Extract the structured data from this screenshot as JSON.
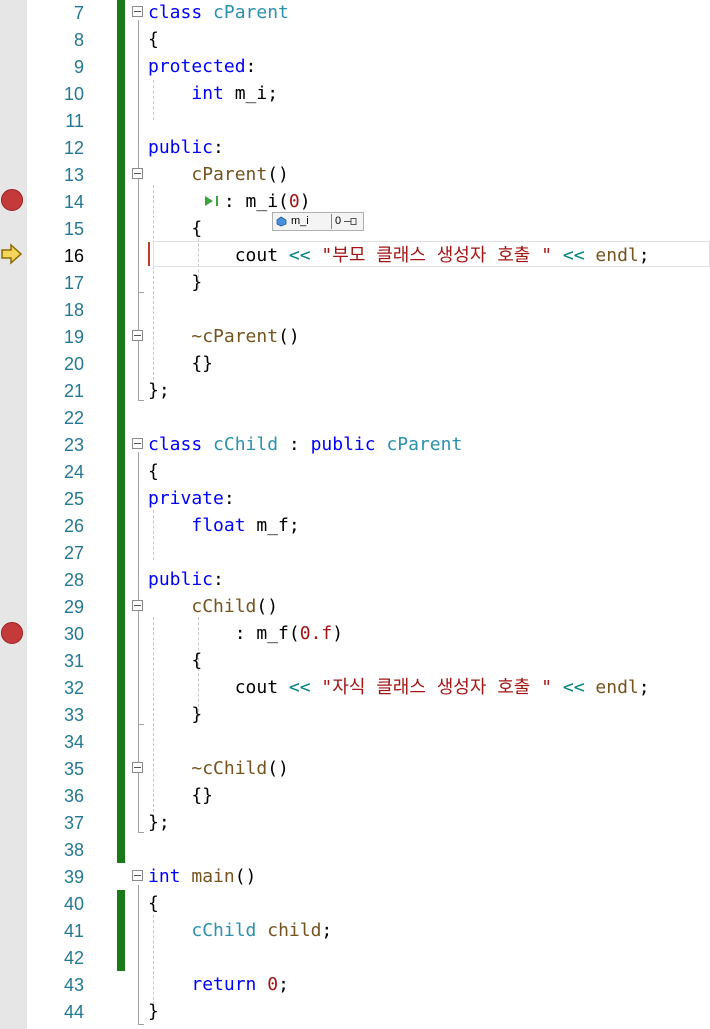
{
  "editor": {
    "lines": [
      {
        "num": "7",
        "tokens": [
          {
            "t": "class",
            "c": "kw"
          },
          {
            "t": " "
          },
          {
            "t": "cParent",
            "c": "type"
          }
        ]
      },
      {
        "num": "8",
        "tokens": [
          {
            "t": "{"
          }
        ]
      },
      {
        "num": "9",
        "tokens": [
          {
            "t": "protected",
            "c": "kw"
          },
          {
            "t": ":"
          }
        ]
      },
      {
        "num": "10",
        "tokens": [
          {
            "t": "    "
          },
          {
            "t": "int",
            "c": "kw"
          },
          {
            "t": " m_i;"
          }
        ]
      },
      {
        "num": "11",
        "tokens": []
      },
      {
        "num": "12",
        "tokens": [
          {
            "t": "public",
            "c": "kw"
          },
          {
            "t": ":"
          }
        ]
      },
      {
        "num": "13",
        "tokens": [
          {
            "t": "    "
          },
          {
            "t": "cParent",
            "c": "fn"
          },
          {
            "t": "()"
          }
        ]
      },
      {
        "num": "14",
        "tokens": [
          {
            "t": "       : m_i("
          },
          {
            "t": "0",
            "c": "num"
          },
          {
            "t": ")"
          }
        ]
      },
      {
        "num": "15",
        "tokens": [
          {
            "t": "    {"
          }
        ]
      },
      {
        "num": "16",
        "tokens": [
          {
            "t": "        cout "
          },
          {
            "t": "<<",
            "c": "op"
          },
          {
            "t": " "
          },
          {
            "t": "\"부모 클래스 생성자 호출 \"",
            "c": "str"
          },
          {
            "t": " "
          },
          {
            "t": "<<",
            "c": "op"
          },
          {
            "t": " "
          },
          {
            "t": "endl",
            "c": "fn"
          },
          {
            "t": ";"
          }
        ]
      },
      {
        "num": "17",
        "tokens": [
          {
            "t": "    }"
          }
        ]
      },
      {
        "num": "18",
        "tokens": []
      },
      {
        "num": "19",
        "tokens": [
          {
            "t": "    "
          },
          {
            "t": "~cParent",
            "c": "fn"
          },
          {
            "t": "()"
          }
        ]
      },
      {
        "num": "20",
        "tokens": [
          {
            "t": "    {}"
          }
        ]
      },
      {
        "num": "21",
        "tokens": [
          {
            "t": "};"
          }
        ]
      },
      {
        "num": "22",
        "tokens": []
      },
      {
        "num": "23",
        "tokens": [
          {
            "t": "class",
            "c": "kw"
          },
          {
            "t": " "
          },
          {
            "t": "cChild",
            "c": "type"
          },
          {
            "t": " : "
          },
          {
            "t": "public",
            "c": "kw"
          },
          {
            "t": " "
          },
          {
            "t": "cParent",
            "c": "type"
          }
        ]
      },
      {
        "num": "24",
        "tokens": [
          {
            "t": "{"
          }
        ]
      },
      {
        "num": "25",
        "tokens": [
          {
            "t": "private",
            "c": "kw"
          },
          {
            "t": ":"
          }
        ]
      },
      {
        "num": "26",
        "tokens": [
          {
            "t": "    "
          },
          {
            "t": "float",
            "c": "kw"
          },
          {
            "t": " m_f;"
          }
        ]
      },
      {
        "num": "27",
        "tokens": []
      },
      {
        "num": "28",
        "tokens": [
          {
            "t": "public",
            "c": "kw"
          },
          {
            "t": ":"
          }
        ]
      },
      {
        "num": "29",
        "tokens": [
          {
            "t": "    "
          },
          {
            "t": "cChild",
            "c": "fn"
          },
          {
            "t": "()"
          }
        ]
      },
      {
        "num": "30",
        "tokens": [
          {
            "t": "        : m_f("
          },
          {
            "t": "0.f",
            "c": "num"
          },
          {
            "t": ")"
          }
        ]
      },
      {
        "num": "31",
        "tokens": [
          {
            "t": "    {"
          }
        ]
      },
      {
        "num": "32",
        "tokens": [
          {
            "t": "        cout "
          },
          {
            "t": "<<",
            "c": "op"
          },
          {
            "t": " "
          },
          {
            "t": "\"자식 클래스 생성자 호출 \"",
            "c": "str"
          },
          {
            "t": " "
          },
          {
            "t": "<<",
            "c": "op"
          },
          {
            "t": " "
          },
          {
            "t": "endl",
            "c": "fn"
          },
          {
            "t": ";"
          }
        ]
      },
      {
        "num": "33",
        "tokens": [
          {
            "t": "    }"
          }
        ]
      },
      {
        "num": "34",
        "tokens": []
      },
      {
        "num": "35",
        "tokens": [
          {
            "t": "    "
          },
          {
            "t": "~cChild",
            "c": "fn"
          },
          {
            "t": "()"
          }
        ]
      },
      {
        "num": "36",
        "tokens": [
          {
            "t": "    {}"
          }
        ]
      },
      {
        "num": "37",
        "tokens": [
          {
            "t": "};"
          }
        ]
      },
      {
        "num": "38",
        "tokens": []
      },
      {
        "num": "39",
        "tokens": [
          {
            "t": "int",
            "c": "kw"
          },
          {
            "t": " "
          },
          {
            "t": "main",
            "c": "fn"
          },
          {
            "t": "()"
          }
        ]
      },
      {
        "num": "40",
        "tokens": [
          {
            "t": "{"
          }
        ]
      },
      {
        "num": "41",
        "tokens": [
          {
            "t": "    "
          },
          {
            "t": "cChild",
            "c": "type"
          },
          {
            "t": " "
          },
          {
            "t": "child",
            "c": "fn"
          },
          {
            "t": ";"
          }
        ]
      },
      {
        "num": "42",
        "tokens": []
      },
      {
        "num": "43",
        "tokens": [
          {
            "t": "    "
          },
          {
            "t": "return",
            "c": "kw"
          },
          {
            "t": " "
          },
          {
            "t": "0",
            "c": "num"
          },
          {
            "t": ";"
          }
        ]
      },
      {
        "num": "44",
        "tokens": [
          {
            "t": "}"
          }
        ]
      }
    ],
    "breakpoint_lines": [
      "14",
      "30"
    ],
    "current_line": "16"
  },
  "datatip": {
    "name": "m_i",
    "value": "0"
  },
  "colors": {
    "keyword": "#0000ff",
    "type": "#2b91af",
    "function": "#74531f",
    "string": "#a31515",
    "line_number": "#237893",
    "change_bar": "#1a7a1a",
    "breakpoint": "#c43a3a"
  }
}
